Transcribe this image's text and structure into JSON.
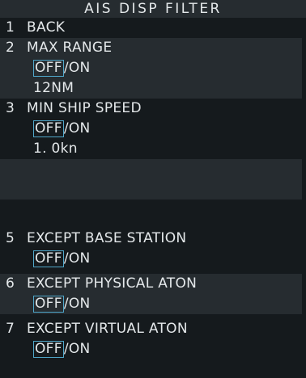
{
  "menu": {
    "title": "AIS DISP FILTER",
    "items": [
      {
        "num": "1",
        "label": "BACK"
      },
      {
        "num": "2",
        "label": "MAX RANGE",
        "toggle": {
          "selected": "OFF",
          "separator": "/",
          "other": "ON"
        },
        "value": "12NM"
      },
      {
        "num": "3",
        "label": "MIN SHIP SPEED",
        "toggle": {
          "selected": "OFF",
          "separator": "/",
          "other": "ON"
        },
        "value": "1. 0kn"
      },
      {
        "num": "5",
        "label": "EXCEPT BASE STATION",
        "toggle": {
          "selected": "OFF",
          "separator": "/",
          "other": "ON"
        }
      },
      {
        "num": "6",
        "label": "EXCEPT PHYSICAL ATON",
        "toggle": {
          "selected": "OFF",
          "separator": "/",
          "other": "ON"
        }
      },
      {
        "num": "7",
        "label": "EXCEPT VIRTUAL ATON",
        "toggle": {
          "selected": "OFF",
          "separator": "/",
          "other": "ON"
        }
      }
    ]
  },
  "colors": {
    "background": "#151a1d",
    "band": "#262c30",
    "text": "#e4e8ea",
    "selection_border": "#4fa6c9"
  }
}
